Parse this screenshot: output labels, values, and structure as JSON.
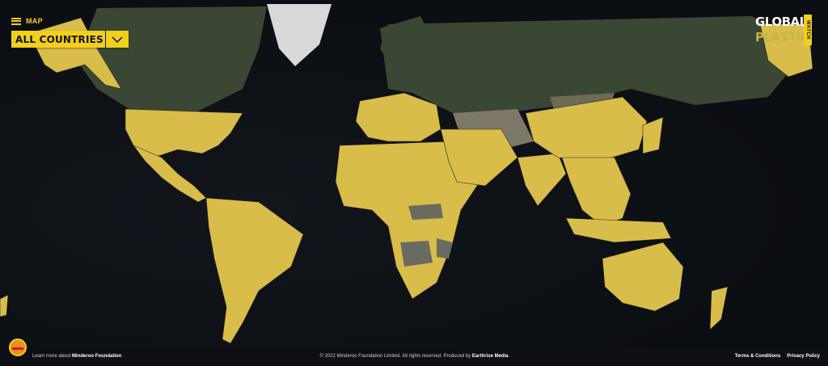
{
  "menu": {
    "label": "MAP"
  },
  "country_filter": {
    "selected": "ALL COUNTRIES"
  },
  "logo": {
    "line1": "GLOBAL",
    "line2": "PLASTIC",
    "tag": "WATCH"
  },
  "footer": {
    "learn_prefix": "Learn more about",
    "learn_link": "Minderoo Foundation",
    "copyright_prefix": "© 2022 Minderoo Foundation Limited. All rights reserved. Produced by",
    "producer": "Earthrise Media",
    "terms": "Terms & Conditions",
    "privacy": "Privacy Policy"
  },
  "colors": {
    "accent": "#f2cf1d",
    "highlight_land": "#d9bd4b",
    "ocean": "#0b0e12",
    "land_dark": "#3a4a36"
  }
}
